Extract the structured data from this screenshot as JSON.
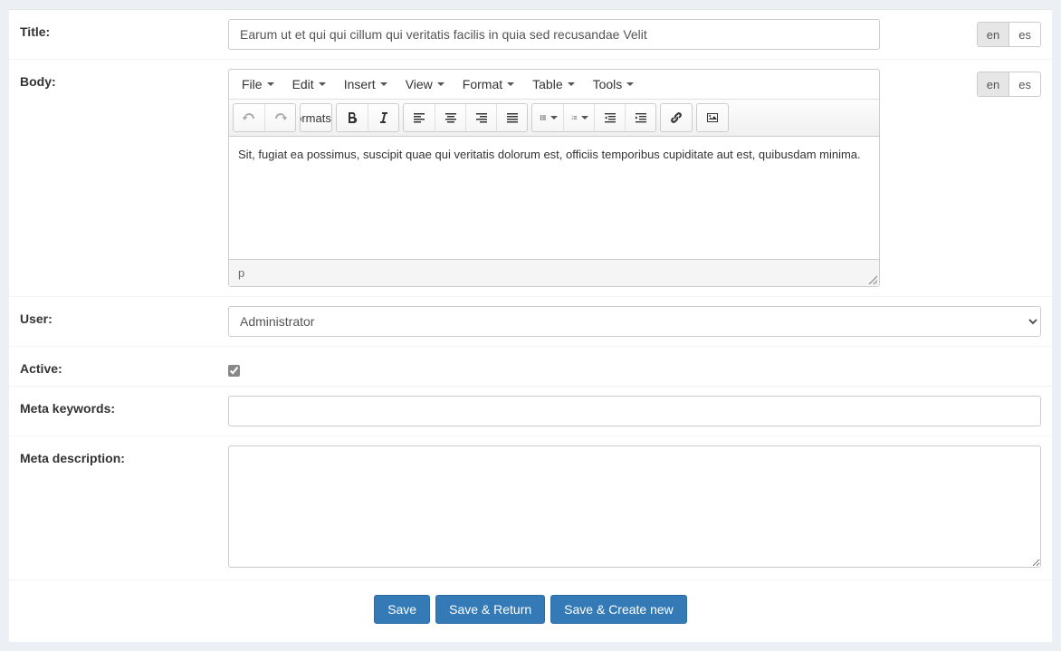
{
  "labels": {
    "title": "Title",
    "body": "Body",
    "user": "User",
    "active": "Active",
    "meta_keywords": "Meta keywords",
    "meta_description": "Meta description"
  },
  "values": {
    "title": "Earum ut et qui qui cillum qui veritatis facilis in quia sed recusandae Velit",
    "body": "Sit, fugiat ea possimus, suscipit quae qui veritatis dolorum est, officiis temporibus cupiditate aut est, quibusdam minima.",
    "user_selected": "Administrator",
    "active": true,
    "meta_keywords": "",
    "meta_description": ""
  },
  "user_options": [
    "Administrator"
  ],
  "lang": {
    "en": "en",
    "es": "es",
    "active": "en"
  },
  "editor": {
    "menus": {
      "file": "File",
      "edit": "Edit",
      "insert": "Insert",
      "view": "View",
      "format": "Format",
      "table": "Table",
      "tools": "Tools"
    },
    "formats_label": "Formats",
    "status_path": "p"
  },
  "buttons": {
    "save": "Save",
    "save_return": "Save & Return",
    "save_create": "Save & Create new"
  }
}
